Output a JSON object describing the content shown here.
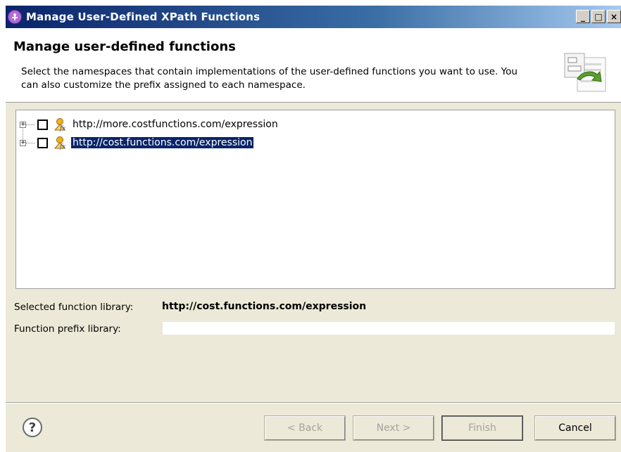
{
  "window": {
    "title": "Manage User-Defined XPath Functions",
    "controls": {
      "minimize": "_",
      "maximize": "□",
      "close": "×"
    }
  },
  "header": {
    "title": "Manage user-defined functions",
    "description": "Select the namespaces that contain implementations of the user-defined functions you want to use. You can also customize the prefix assigned to each namespace."
  },
  "tree": {
    "items": [
      {
        "label": "http://more.costfunctions.com/expression",
        "checked": false,
        "selected": false
      },
      {
        "label": "http://cost.functions.com/expression",
        "checked": false,
        "selected": true
      }
    ]
  },
  "details": {
    "selected_label": "Selected function library:",
    "selected_value": "http://cost.functions.com/expression",
    "prefix_label": "Function prefix library:",
    "prefix_value": ""
  },
  "footer": {
    "help": "?",
    "back": "< Back",
    "next": "Next >",
    "finish": "Finish",
    "cancel": "Cancel"
  },
  "icons": {
    "app": "app-icon",
    "wizard": "wizard-banner-icon",
    "function": "function-library-icon",
    "help": "help-icon"
  },
  "colors": {
    "titlebar_start": "#0a246a",
    "selection": "#0a246a",
    "dialog_bg": "#ece9d8"
  }
}
